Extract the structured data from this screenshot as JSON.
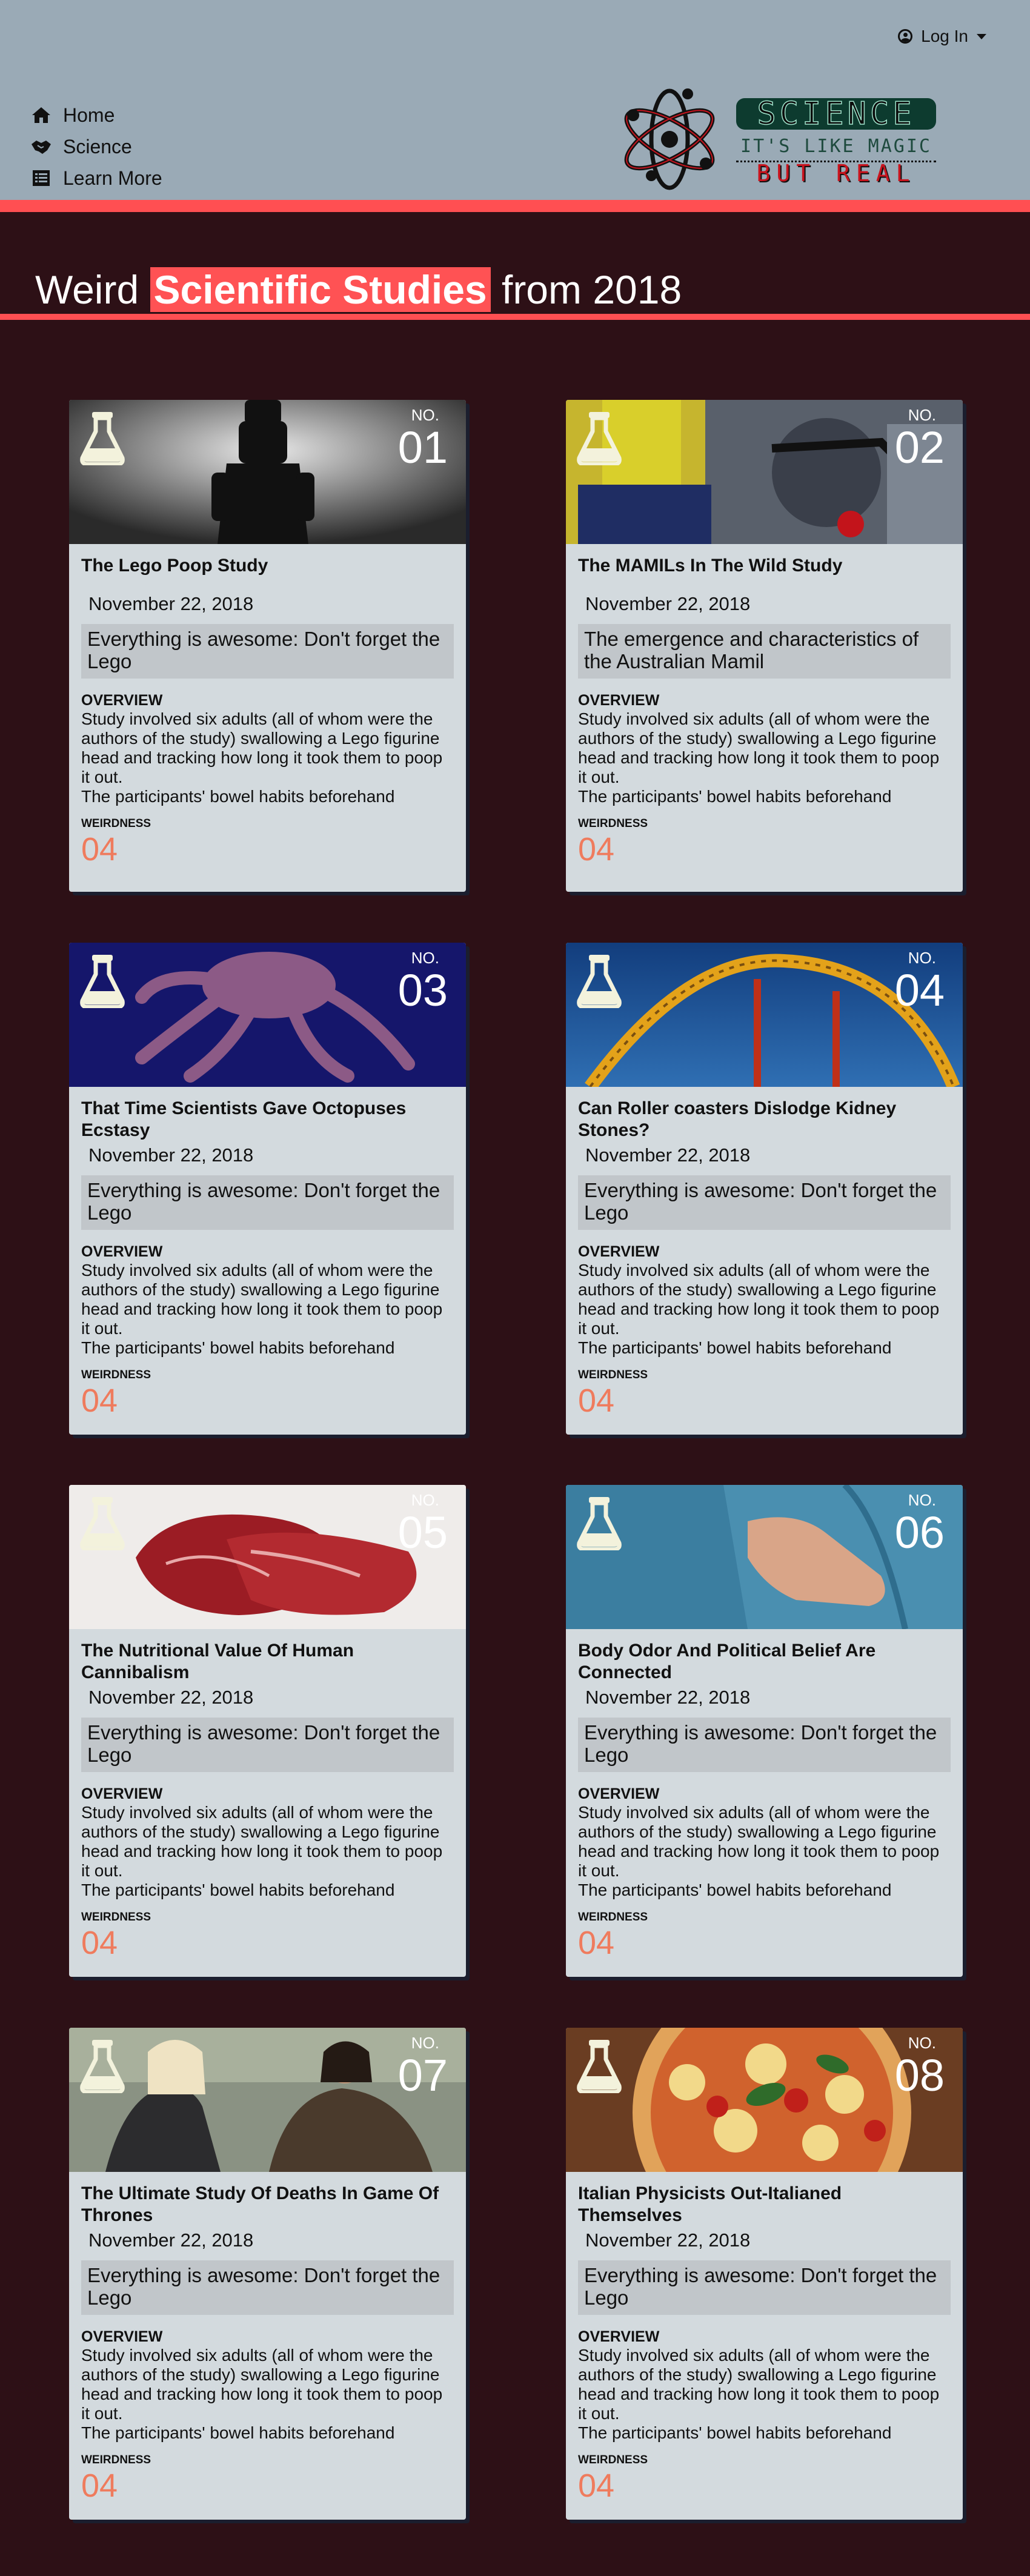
{
  "header": {
    "login_label": "Log In",
    "nav": [
      {
        "label": "Home",
        "icon": "home-icon"
      },
      {
        "label": "Science",
        "icon": "handshake-icon"
      },
      {
        "label": "Learn More",
        "icon": "list-icon"
      }
    ],
    "logo": {
      "word": "SCIENCE",
      "line2": "IT'S LIKE MAGIC",
      "line3": "BUT REAL"
    }
  },
  "title": {
    "prefix": "Weird",
    "highlight": "Scientific Studies",
    "suffix": "from 2018"
  },
  "colors": {
    "page_bg": "#2d1016",
    "header_bg": "#9aaab6",
    "accent": "#ff4f52",
    "card_bg": "#d3dade",
    "weirdness": "#ef7b5d"
  },
  "card_labels": {
    "no": "NO.",
    "overview": "OVERVIEW",
    "weirdness": "WEIRDNESS"
  },
  "studies": [
    {
      "number": "01",
      "title": "The Lego Poop Study",
      "date": "November 22, 2018",
      "summary": "Everything is awesome: Don't forget the Lego",
      "overview": "Study involved six adults (all of whom were the authors of the study) swallowing a Lego figurine head and tracking how long it took them to poop it out.",
      "overview_more": "The participants' bowel habits beforehand",
      "weirdness": "04",
      "image": "lego-figure"
    },
    {
      "number": "02",
      "title": "The MAMILs In The Wild Study",
      "date": "November 22, 2018",
      "summary": "The emergence and characteristics of the Australian Mamil",
      "overview": "Study involved six adults (all of whom were the authors of the study) swallowing a Lego figurine head and tracking how long it took them to poop it out.",
      "overview_more": "The participants' bowel habits beforehand",
      "weirdness": "04",
      "image": "cyclist"
    },
    {
      "number": "03",
      "title": "That Time Scientists Gave Octopuses Ecstasy",
      "date": "November 22, 2018",
      "summary": "Everything is awesome: Don't forget the Lego",
      "overview": "Study involved six adults (all of whom were the authors of the study) swallowing a Lego figurine head and tracking how long it took them to poop it out.",
      "overview_more": "The participants' bowel habits beforehand",
      "weirdness": "04",
      "image": "octopus"
    },
    {
      "number": "04",
      "title": "Can Roller coasters Dislodge Kidney Stones?",
      "date": "November 22, 2018",
      "summary": "Everything is awesome: Don't forget the Lego",
      "overview": "Study involved six adults (all of whom were the authors of the study) swallowing a Lego figurine head and tracking how long it took them to poop it out.",
      "overview_more": "The participants' bowel habits beforehand",
      "weirdness": "04",
      "image": "roller-coaster"
    },
    {
      "number": "05",
      "title": "The Nutritional Value Of Human Cannibalism",
      "date": "November 22, 2018",
      "summary": "Everything is awesome: Don't forget the Lego",
      "overview": "Study involved six adults (all of whom were the authors of the study) swallowing a Lego figurine head and tracking how long it took them to poop it out.",
      "overview_more": "The participants' bowel habits beforehand",
      "weirdness": "04",
      "image": "raw-meat"
    },
    {
      "number": "06",
      "title": "Body Odor And Political Belief Are Connected",
      "date": "November 22, 2018",
      "summary": "Everything is awesome: Don't forget the Lego",
      "overview": "Study involved six adults (all of whom were the authors of the study) swallowing a Lego figurine head and tracking how long it took them to poop it out.",
      "overview_more": "The participants' bowel habits beforehand",
      "weirdness": "04",
      "image": "sweaty-shirt"
    },
    {
      "number": "07",
      "title": "The Ultimate Study Of Deaths In Game Of Thrones",
      "date": "November 22, 2018",
      "summary": "Everything is awesome: Don't forget the Lego",
      "overview": "Study involved six adults (all of whom were the authors of the study) swallowing a Lego figurine head and tracking how long it took them to poop it out.",
      "overview_more": "The participants' bowel habits beforehand",
      "weirdness": "04",
      "image": "game-of-thrones"
    },
    {
      "number": "08",
      "title": "Italian Physicists Out-Italianed Themselves",
      "date": "November 22, 2018",
      "summary": "Everything is awesome: Don't forget the Lego",
      "overview": "Study involved six adults (all of whom were the authors of the study) swallowing a Lego figurine head and tracking how long it took them to poop it out.",
      "overview_more": "The participants' bowel habits beforehand",
      "weirdness": "04",
      "image": "pizza"
    }
  ]
}
